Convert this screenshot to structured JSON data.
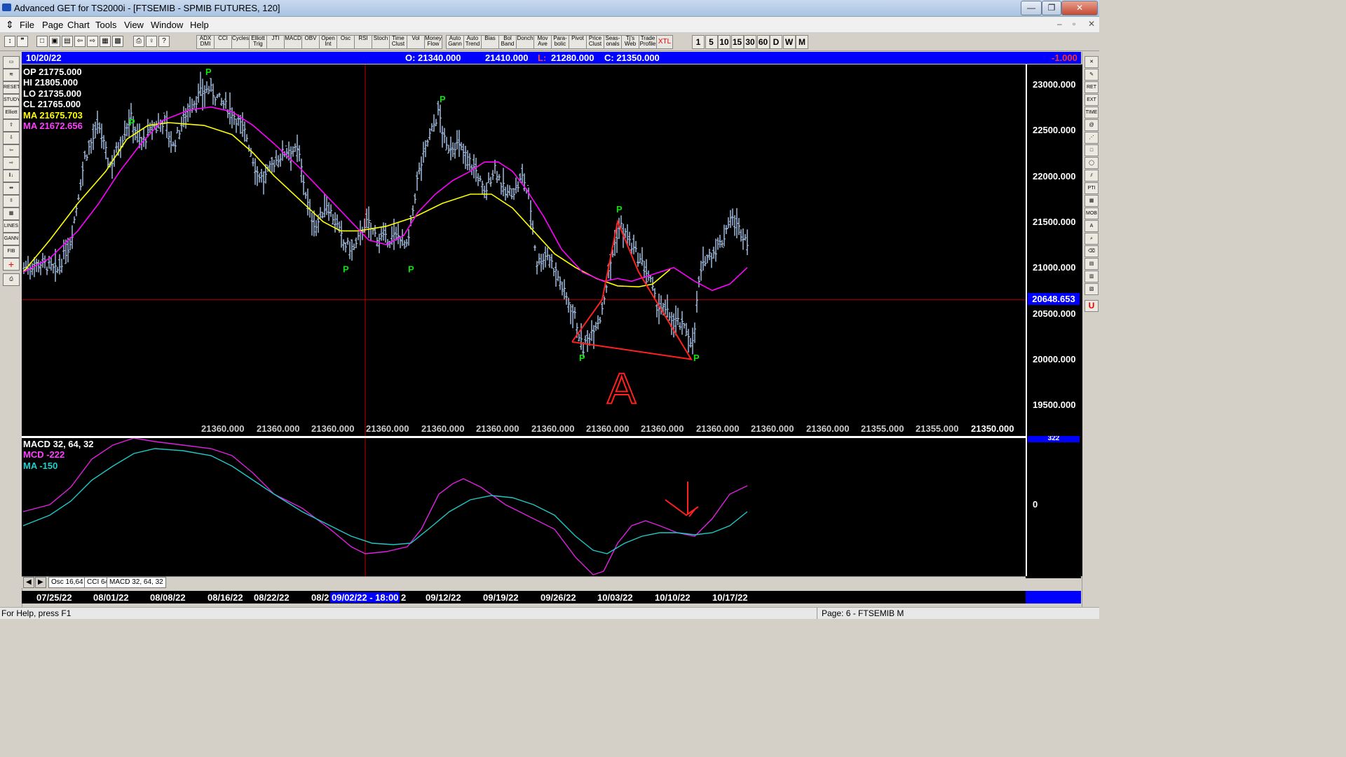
{
  "window": {
    "title": "Advanced GET for TS2000i - [FTSEMIB - SPMIB FUTURES, 120]",
    "minimize": "—",
    "maximize": "❐",
    "close": "✕",
    "child_min": "–",
    "child_max": "▫",
    "child_close": "✕"
  },
  "menu": [
    "File",
    "Page",
    "Chart",
    "Tools",
    "View",
    "Window",
    "Help"
  ],
  "toolbar": {
    "studies": [
      "ADX DMI",
      "CCI",
      "Cycles",
      "Elliott Trig",
      "JTI",
      "MACD",
      "OBV",
      "Open Int",
      "Osc",
      "RSI",
      "Stoch",
      "Time Clust",
      "Vol",
      "Money Flow",
      "Auto Gann",
      "Auto Trend",
      "Bias",
      "Bol Band",
      "Donch",
      "Mov Ave",
      "Para- bolic",
      "Pivot",
      "Price Clust",
      "Seas- onals",
      "Tj's Web",
      "Trade Profile",
      "XTL"
    ],
    "periods": [
      "1",
      "5",
      "10",
      "15",
      "30",
      "60",
      "D",
      "W",
      "M"
    ]
  },
  "infobar": {
    "date": "10/20/22",
    "open": "O: 21340.000",
    "high": "21410.000",
    "low_label": "L:",
    "low": "21280.000",
    "close": "C: 21350.000",
    "change": "-1.000"
  },
  "ohlc_panel": {
    "op": "OP  21775.000",
    "hi": "HI   21805.000",
    "lo": "LO  21735.000",
    "cl": "CL  21765.000",
    "ma1": "MA  21675.703",
    "ma2": "MA  21672.656"
  },
  "price_axis": [
    "23000.000",
    "22500.000",
    "22000.000",
    "21500.000",
    "21000.000",
    "20500.000",
    "20000.000",
    "19500.000"
  ],
  "cursor_price": "20648.653",
  "bottom_values": [
    "21360.000",
    "21360.000",
    "21360.000",
    "21360.000",
    "21360.000",
    "21360.000",
    "21360.000",
    "21360.000",
    "21360.000",
    "21360.000",
    "21360.000",
    "21360.000",
    "21355.000",
    "21355.000",
    "21350.000"
  ],
  "pivot_label": "P",
  "annotation_letter": "A",
  "macd_panel": {
    "title": "MACD 32, 64, 32",
    "mcd": "MCD -222",
    "ma": "MA   -150",
    "zero_label": "0",
    "top_label": "322"
  },
  "tabs": [
    "Osc 16,64",
    "CCI 64",
    "MACD 32, 64, 32"
  ],
  "tab_nav": [
    "◀",
    "▶"
  ],
  "dates": [
    "07/25/22",
    "08/01/22",
    "08/08/22",
    "08/16/22",
    "08/22/22",
    "08/2",
    "09/12/22",
    "09/19/22",
    "09/26/22",
    "10/03/22",
    "10/10/22",
    "10/17/22"
  ],
  "cursor_date": "09/02/22 - 18:00",
  "cursor_date_tail": "2",
  "status": {
    "help": "For Help, press F1",
    "page": "Page: 6 - FTSEMIB M"
  },
  "colors": {
    "ma_yellow": "#ffff00",
    "ma_magenta": "#ff00ff",
    "price_bar": "#a9c8ee",
    "macd_line": "#e020e0",
    "signal_line": "#20c8c8",
    "annotation_red": "#ff2020",
    "infobar_blue": "#0000ff"
  }
}
